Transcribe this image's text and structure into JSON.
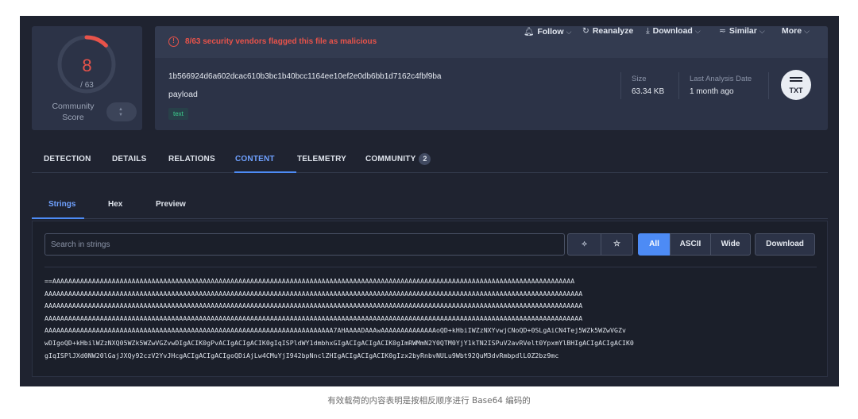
{
  "score": {
    "detections": "8",
    "total": "/ 63",
    "community_label": "Community Score",
    "ring_fraction": 0.127
  },
  "alert": {
    "text": "8/63 security vendors flagged this file as malicious"
  },
  "actions": {
    "follow": "Follow",
    "reanalyze": "Reanalyze",
    "download": "Download",
    "similar": "Similar",
    "more": "More"
  },
  "file": {
    "hash": "1b566924d6a602dcac610b3bc1b40bcc1164ee10ef2e0db6bb1d7162c4fbf9ba",
    "name": "payload",
    "tag": "text",
    "size_label": "Size",
    "size_value": "63.34 KB",
    "analysis_label": "Last Analysis Date",
    "analysis_value": "1 month ago",
    "type_badge": "TXT"
  },
  "tabs": {
    "detection": "DETECTION",
    "details": "DETAILS",
    "relations": "RELATIONS",
    "content": "CONTENT",
    "telemetry": "TELEMETRY",
    "community": "COMMUNITY",
    "community_count": "2"
  },
  "subtabs": {
    "strings": "Strings",
    "hex": "Hex",
    "preview": "Preview"
  },
  "toolbar": {
    "search_placeholder": "Search in strings",
    "all": "All",
    "ascii": "ASCII",
    "wide": "Wide",
    "download": "Download"
  },
  "strings": [
    "==AAAAAAAAAAAAAAAAAAAAAAAAAAAAAAAAAAAAAAAAAAAAAAAAAAAAAAAAAAAAAAAAAAAAAAAAAAAAAAAAAAAAAAAAAAAAAAAAAAAAAAAAAAAAAAAAAAAAAAAAAAAAAAAAAAAA",
    "AAAAAAAAAAAAAAAAAAAAAAAAAAAAAAAAAAAAAAAAAAAAAAAAAAAAAAAAAAAAAAAAAAAAAAAAAAAAAAAAAAAAAAAAAAAAAAAAAAAAAAAAAAAAAAAAAAAAAAAAAAAAAAAAAAAAAAAA",
    "AAAAAAAAAAAAAAAAAAAAAAAAAAAAAAAAAAAAAAAAAAAAAAAAAAAAAAAAAAAAAAAAAAAAAAAAAAAAAAAAAAAAAAAAAAAAAAAAAAAAAAAAAAAAAAAAAAAAAAAAAAAAAAAAAAAAAAAA",
    "AAAAAAAAAAAAAAAAAAAAAAAAAAAAAAAAAAAAAAAAAAAAAAAAAAAAAAAAAAAAAAAAAAAAAAAAAAAAAAAAAAAAAAAAAAAAAAAAAAAAAAAAAAAAAAAAAAAAAAAAAAAAAAAAAAAAAAAA",
    "AAAAAAAAAAAAAAAAAAAAAAAAAAAAAAAAAAAAAAAAAAAAAAAAAAAAAAAAAAAAAAAAAAAAAAAAA7AHAAAADAAAwAAAAAAAAAAAAAAoQD+kHbiIWZzNXYvwjCNoQD+0SLgAiCN4Tej5WZk5WZwVGZv",
    "wDIgoQD+kHbilWZzNXQ05WZk5WZwVGZvwDIgACIK0gPvACIgACIgACIK0gIqISPldWY1dmbhxGIgACIgACIgACIK0gImRWMmN2Y0QTM0YjY1kTN2ISPuV2avRVelt0YpxmYlBHIgACIgACIgACIK0",
    "gIqISPlJXd0NW20lGajJXQy92czV2YvJHcgACIgACIgACIgoQDiAjLw4CMuYjI942bpNnclZHIgACIgACIgACIK0gIzx2byRnbvNULu9Wbt92QuM3dvRmbpdlL0Z2bz9mc"
  ],
  "caption": "有效载荷的内容表明是按相反顺序进行 Base64 编码的"
}
